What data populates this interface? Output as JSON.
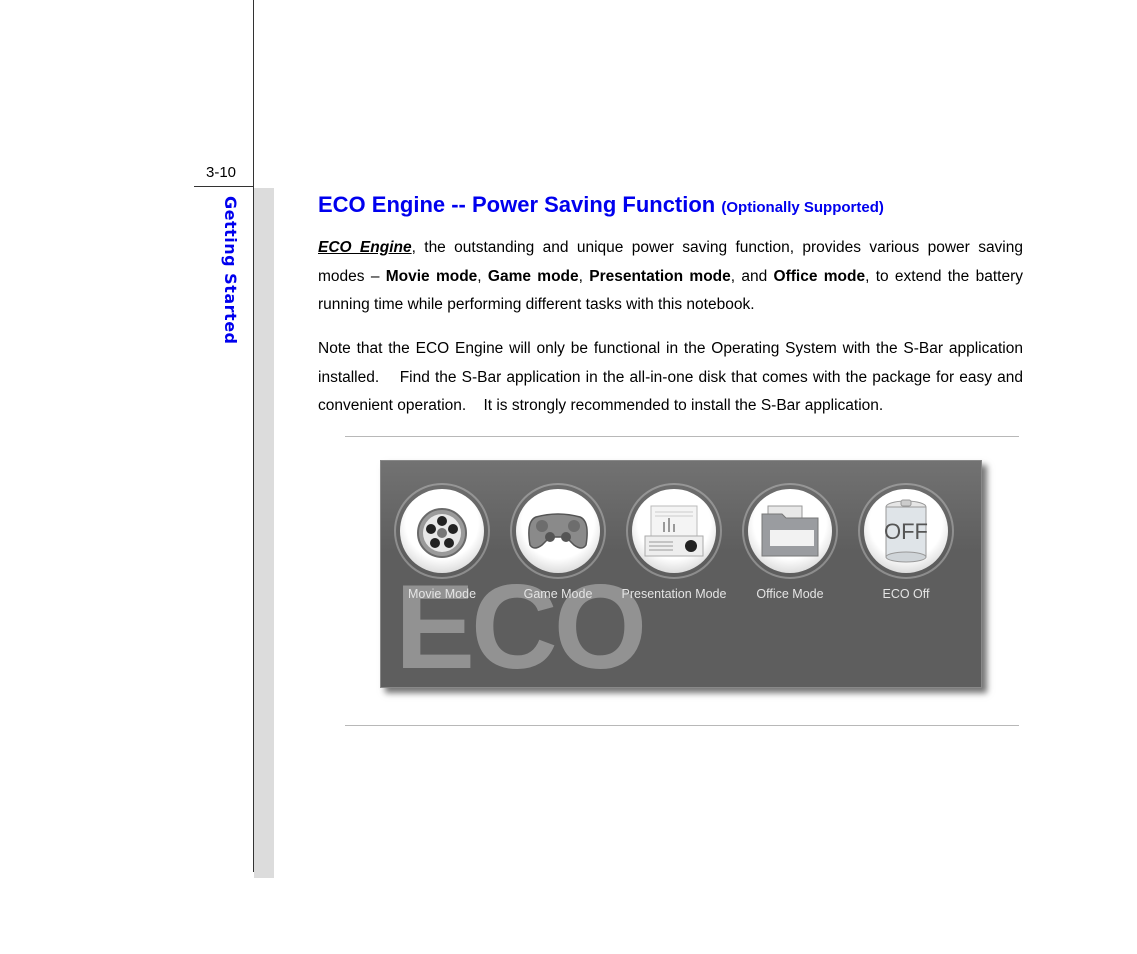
{
  "page_number": "3-10",
  "section_title": "Getting Started",
  "heading": {
    "title": "ECO Engine -- Power Saving Function",
    "note": "(Optionally Supported)"
  },
  "paragraph1": {
    "lead": "ECO Engine",
    "t1": ", the outstanding and unique power saving function, provides various power saving modes – ",
    "b1": "Movie mode",
    "t2": ", ",
    "b2": "Game mode",
    "t3": ", ",
    "b3": "Presentation mode",
    "t4": ", and ",
    "b4": "Office mode",
    "t5": ", to extend the battery running time while performing different tasks with this notebook."
  },
  "paragraph2": "Note that the ECO Engine will only be functional in the Operating System with the S-Bar application installed.    Find the S-Bar application in the all-in-one disk that comes with the package for easy and convenient operation.    It is strongly recommended to install the S-Bar application.",
  "eco_panel": {
    "watermark": "ECO",
    "modes": [
      {
        "label": "Movie Mode",
        "icon": "film-reel-icon"
      },
      {
        "label": "Game Mode",
        "icon": "gamepad-icon"
      },
      {
        "label": "Presentation Mode",
        "icon": "projector-icon"
      },
      {
        "label": "Office Mode",
        "icon": "folder-icon"
      },
      {
        "label": "ECO Off",
        "icon": "battery-off-icon",
        "icon_text": "OFF"
      }
    ]
  }
}
